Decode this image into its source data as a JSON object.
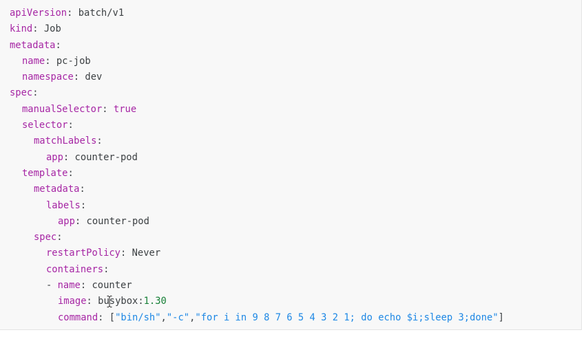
{
  "code": {
    "apiVersion_key": "apiVersion",
    "apiVersion_val": "batch/v1",
    "kind_key": "kind",
    "kind_val": "Job",
    "metadata_key": "metadata",
    "name_key": "name",
    "name_val": "pc-job",
    "namespace_key": "namespace",
    "namespace_val": "dev",
    "spec_key": "spec",
    "manualSelector_key": "manualSelector",
    "manualSelector_val": "true",
    "selector_key": "selector",
    "matchLabels_key": "matchLabels",
    "app_key": "app",
    "app_val": "counter-pod",
    "template_key": "template",
    "tmpl_metadata_key": "metadata",
    "labels_key": "labels",
    "labels_app_key": "app",
    "labels_app_val": "counter-pod",
    "tmpl_spec_key": "spec",
    "restartPolicy_key": "restartPolicy",
    "restartPolicy_val": "Never",
    "containers_key": "containers",
    "container_name_key": "name",
    "container_name_val": "counter",
    "image_key": "image",
    "image_val": "busybox:",
    "image_version": "1.30",
    "command_key": "command",
    "command_open": "[",
    "command_arg1": "\"bin/sh\"",
    "command_arg2": "\"-c\"",
    "command_arg3": "\"for i in 9 8 7 6 5 4 3 2 1; do echo $i;sleep 3;done\"",
    "command_close": "]"
  },
  "colors": {
    "key": "#a626a4",
    "boolean": "#a626a4",
    "number": "#188038",
    "string": "#1e88e5",
    "text": "#3c4043",
    "background": "#f8f8f8"
  },
  "cursor": "text-cursor-icon"
}
